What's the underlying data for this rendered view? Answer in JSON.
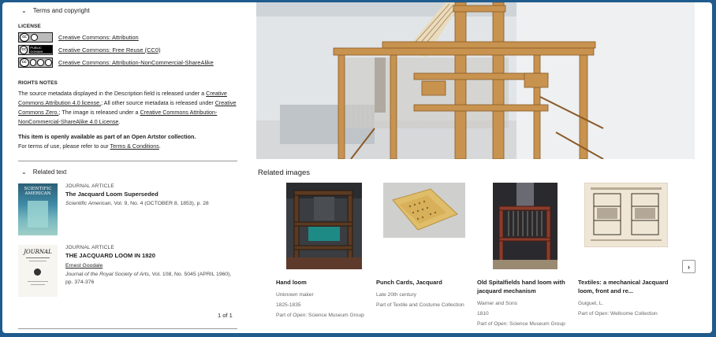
{
  "terms": {
    "header": "Terms and copyright",
    "license_label": "LICENSE",
    "licenses": [
      {
        "badge": "CC BY",
        "label": "Creative Commons: Attribution"
      },
      {
        "badge": "PUBLIC DOMAIN",
        "label": "Creative Commons: Free Reuse (CC0)"
      },
      {
        "badge": "BY NC SA",
        "label": "Creative Commons: Attribution-NonCommercial-ShareAlike"
      }
    ],
    "rights_label": "RIGHTS NOTES",
    "rights": {
      "p1": "The source metadata displayed in the Description field is released under a",
      "l1": "Creative Commons Attribution 4.0 license.",
      "p2": "; All other source metadata is released under",
      "l2": "Creative Commons Zero.",
      "p3": "; The image is released under a",
      "l3": "Creative Commons Attribution-NonCommercial-ShareAlike 4.0 License",
      "p4": "."
    },
    "open_note_bold": "This item is openly available as part of an Open Artstor collection.",
    "open_note_prefix": "For terms of use, please refer to our",
    "open_note_link": "Terms & Conditions",
    "open_note_suffix": "."
  },
  "related_text": {
    "header": "Related text",
    "items": [
      {
        "type": "JOURNAL ARTICLE",
        "title": "The Jacquard Loom Superseded",
        "author": "",
        "source_italic": "Scientific American",
        "source_rest": ", Vol. 9, No. 4 (OCTOBER 8, 1853), p. 28",
        "thumb_text": "SCIENTIFIC AMERICAN"
      },
      {
        "type": "JOURNAL ARTICLE",
        "title": "THE JACQUARD LOOM IN 1820",
        "author": "Ernest Goodale",
        "source_italic": "Journal of the Royal Society of Arts",
        "source_rest": ", Vol. 108, No. 5045 (APRIL 1960), pp. 374-376",
        "thumb_text": "JOURNAL"
      }
    ],
    "pagination": "1 of 1"
  },
  "related_images": {
    "header": "Related images",
    "items": [
      {
        "title": "Hand loom",
        "lines": [
          "Unknown maker",
          "1825-1835",
          "Part of Open: Science Museum Group"
        ]
      },
      {
        "title": "Punch Cards, Jacquard",
        "lines": [
          "Late 20th century",
          "Part of Textile and Costume Collection"
        ]
      },
      {
        "title": "Old Spitalfields hand loom with jacquard mechanism",
        "lines": [
          "Warner and Sons",
          "1810",
          "Part of Open: Science Museum Group"
        ]
      },
      {
        "title": "Textiles: a mechanical Jacquard loom, front and re...",
        "lines": [
          "Guiguet, L.",
          "Part of Open: Wellcome Collection"
        ]
      }
    ],
    "next_icon": "chevron-right-icon"
  },
  "colors": {
    "frame": "#1f5b8c",
    "wood": "#c8924f",
    "background": "#ffffff"
  }
}
